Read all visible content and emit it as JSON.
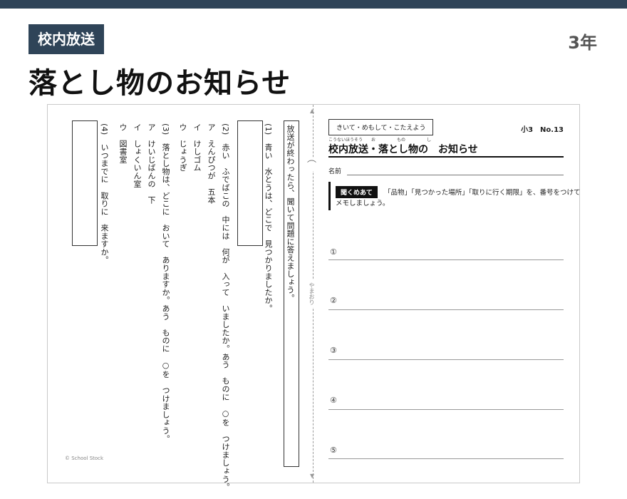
{
  "header": {
    "category": "校内放送",
    "grade": "3年",
    "title": "落とし物のお知らせ"
  },
  "sheet": {
    "right_header": "きいて・めもして・こたえよう",
    "code": "小3　No.13",
    "furigana": "こうないほうそう　　お　　　　　もの　　　　　し",
    "lesson_title": "校内放送・落とし物の　お知らせ",
    "name_label": "名前",
    "badge": "聞くめあて",
    "instruction_line1": "「品物」「見つかった場所」「取りに行く期限」を、番号をつけて",
    "instruction_line2": "メモしましょう。",
    "answer_numbers": [
      "①",
      "②",
      "③",
      "④",
      "⑤"
    ],
    "fold_label": "やまおり",
    "fold_icon": "fold-arrow-icon",
    "instruction_vertical": "放送が終わったら、聞いて問題に答えましょう。",
    "q1": "(1)　青い　水とうは、どこで　見つかりましたか。",
    "q2": "(2)　赤い　ふでばこの　中には　何が　入って　いましたか。あう　ものに　○を　つけましょう。",
    "q2_options": [
      "ア　えんぴつが　五本",
      "イ　けしゴム",
      "ウ　じょうぎ"
    ],
    "q3": "(3)　落とし物は、どこに　おいて　ありますか。あう　ものに　○を　つけましょう。",
    "q3_options": [
      "ア　けいじばんの　下",
      "イ　しょくいん室",
      "ウ　図書室"
    ],
    "q4": "(4)　いつまでに　取りに　来ますか。",
    "copyright": "© School Stock"
  },
  "colors": {
    "header_bar": "#2f4458",
    "badge_bg": "#111111"
  }
}
